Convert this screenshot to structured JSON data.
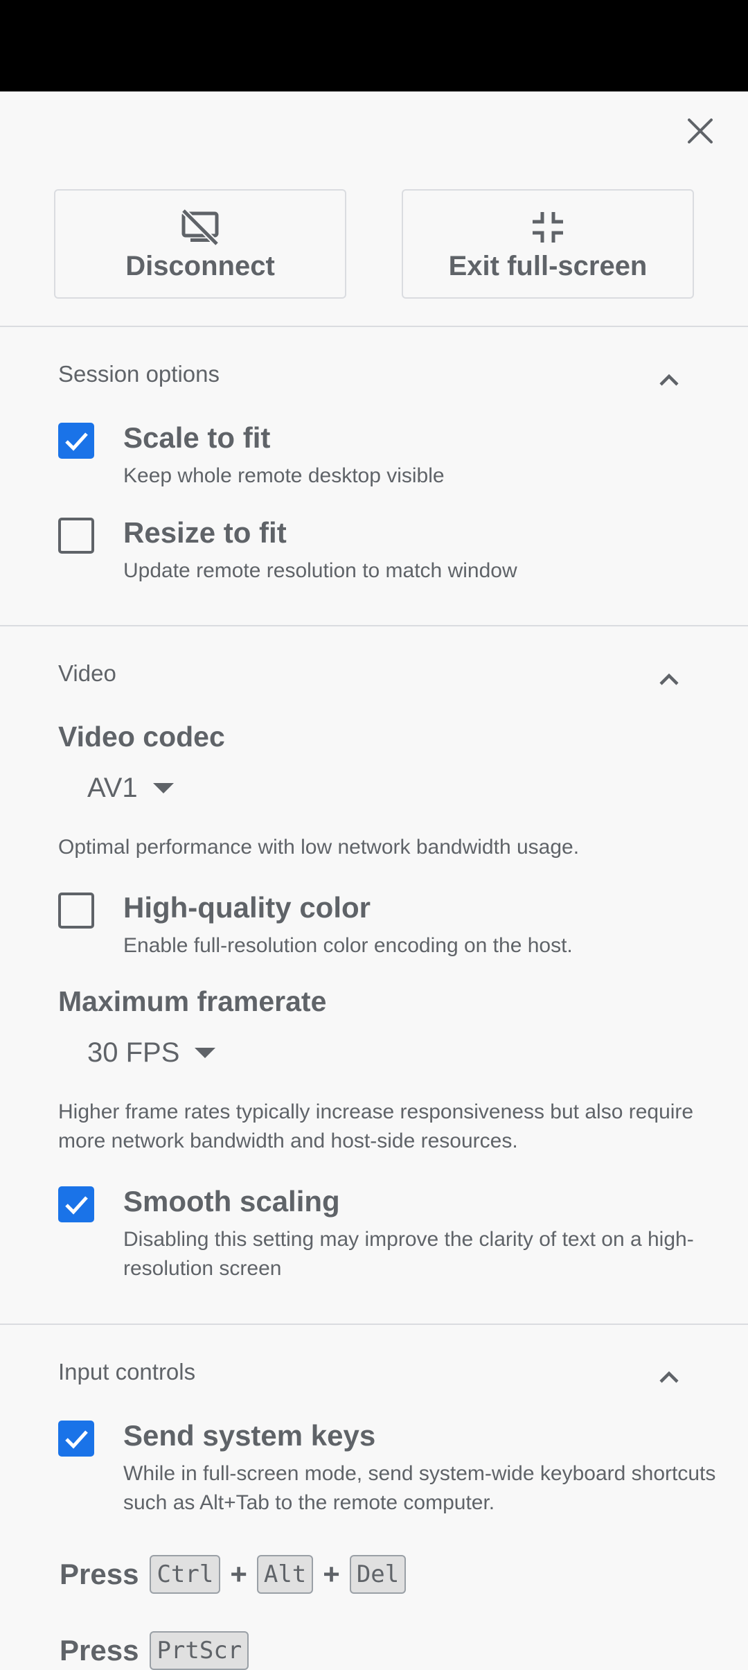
{
  "actions": {
    "disconnect_label": "Disconnect",
    "exit_fullscreen_label": "Exit full-screen"
  },
  "session": {
    "title": "Session options",
    "options": [
      {
        "label": "Scale to fit",
        "desc": "Keep whole remote desktop visible",
        "checked": true
      },
      {
        "label": "Resize to fit",
        "desc": "Update remote resolution to match window",
        "checked": false
      }
    ]
  },
  "video": {
    "title": "Video",
    "codec_label": "Video codec",
    "codec_value": "AV1",
    "codec_desc": "Optimal performance with low network bandwidth usage.",
    "hq_color": {
      "label": "High-quality color",
      "desc": "Enable full-resolution color encoding on the host.",
      "checked": false
    },
    "framerate_label": "Maximum framerate",
    "framerate_value": "30 FPS",
    "framerate_desc": "Higher frame rates typically increase responsiveness but also require more network bandwidth and host-side resources.",
    "smooth": {
      "label": "Smooth scaling",
      "desc": "Disabling this setting may improve the clarity of text on a high-resolution screen",
      "checked": true
    }
  },
  "input": {
    "title": "Input controls",
    "system_keys": {
      "label": "Send system keys",
      "desc": "While in full-screen mode, send system-wide keyboard shortcuts such as Alt+Tab to the remote computer.",
      "checked": true
    },
    "press_label": "Press",
    "plus": "+",
    "cad_keys": [
      "Ctrl",
      "Alt",
      "Del"
    ],
    "prtscr_key": "PrtScr"
  },
  "colors": {
    "accent": "#1a73e8",
    "text": "#5f6368",
    "background": "#f8f8f8",
    "divider": "#dadce0"
  },
  "icons": [
    "close-icon",
    "disconnect-monitor-icon",
    "exit-fullscreen-icon",
    "chevron-up-icon",
    "checkmark-icon",
    "dropdown-caret-icon"
  ]
}
